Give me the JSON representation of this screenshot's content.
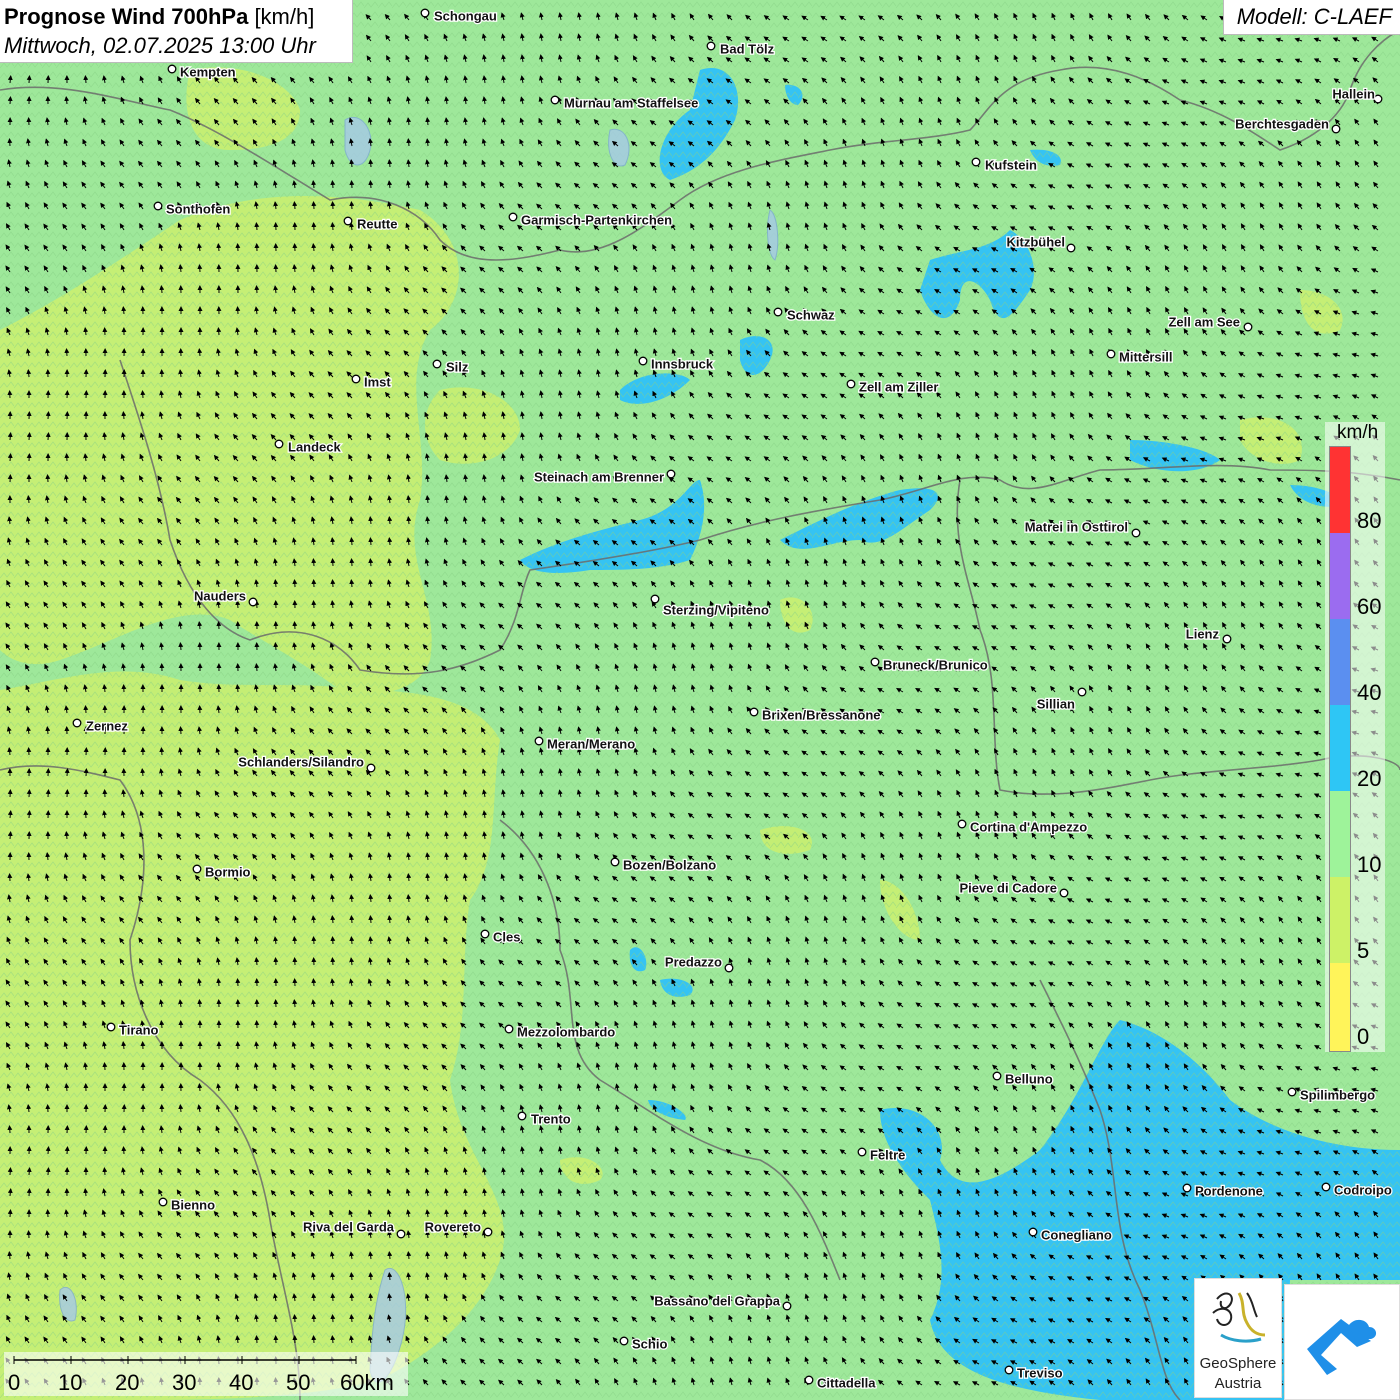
{
  "header": {
    "title_bold": "Prognose Wind 700hPa",
    "title_unit": "[km/h]",
    "subtitle": "Mittwoch, 02.07.2025 13:00 Uhr",
    "model": "Modell: C-LAEF"
  },
  "legend": {
    "unit": "km/h",
    "ticks": [
      "80",
      "60",
      "40",
      "20",
      "10",
      "5",
      "0"
    ],
    "colors": [
      "#ff3333",
      "#9b6cf0",
      "#5b8ff0",
      "#2ec6f5",
      "#9ef39a",
      "#cdf267",
      "#fff45a"
    ]
  },
  "scalebar": {
    "labels": [
      "0",
      "10",
      "20",
      "30",
      "40",
      "50",
      "60km"
    ]
  },
  "logos": {
    "geosphere_name": "GeoSphere",
    "geosphere_sub": "Austria"
  },
  "cities": [
    {
      "name": "Schongau"
    },
    {
      "name": "Kempten"
    },
    {
      "name": "Bad Tölz"
    },
    {
      "name": "Murnau am Staffelsee"
    },
    {
      "name": "Hallein"
    },
    {
      "name": "Berchtesgaden"
    },
    {
      "name": "Kufstein"
    },
    {
      "name": "Sonthofen"
    },
    {
      "name": "Reutte"
    },
    {
      "name": "Garmisch-Partenkirchen"
    },
    {
      "name": "Kitzbühel"
    },
    {
      "name": "Schwaz"
    },
    {
      "name": "Zell am See"
    },
    {
      "name": "Mittersill"
    },
    {
      "name": "Imst"
    },
    {
      "name": "Silz"
    },
    {
      "name": "Innsbruck"
    },
    {
      "name": "Zell am Ziller"
    },
    {
      "name": "Landeck"
    },
    {
      "name": "Steinach am Brenner"
    },
    {
      "name": "Matrei in Osttirol"
    },
    {
      "name": "Nauders"
    },
    {
      "name": "Sterzing/Vipiteno"
    },
    {
      "name": "Lienz"
    },
    {
      "name": "Bruneck/Brunico"
    },
    {
      "name": "Sillian"
    },
    {
      "name": "Zernez"
    },
    {
      "name": "Brixen/Bressanone"
    },
    {
      "name": "Meran/Merano"
    },
    {
      "name": "Schlanders/Silandro"
    },
    {
      "name": "Cortina d'Ampezzo"
    },
    {
      "name": "Bozen/Bolzano"
    },
    {
      "name": "Bormio"
    },
    {
      "name": "Pieve di Cadore"
    },
    {
      "name": "Cles"
    },
    {
      "name": "Predazzo"
    },
    {
      "name": "Tirano"
    },
    {
      "name": "Mezzolombardo"
    },
    {
      "name": "Belluno"
    },
    {
      "name": "Spilimbergo"
    },
    {
      "name": "Trento"
    },
    {
      "name": "Feltre"
    },
    {
      "name": "Pordenone"
    },
    {
      "name": "Codroipo"
    },
    {
      "name": "Bienno"
    },
    {
      "name": "Riva del Garda"
    },
    {
      "name": "Rovereto"
    },
    {
      "name": "Conegliano"
    },
    {
      "name": "Bassano del Grappa"
    },
    {
      "name": "Schio"
    },
    {
      "name": "Treviso"
    },
    {
      "name": "Cittadella"
    }
  ]
}
